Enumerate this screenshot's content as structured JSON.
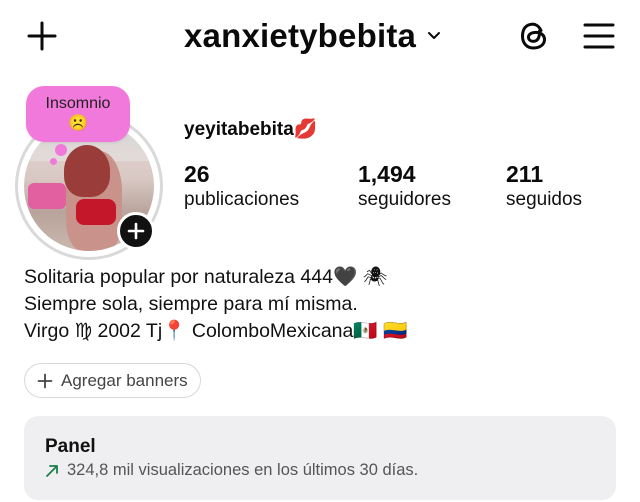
{
  "header": {
    "username": "xanxietybebita",
    "icons": [
      "plus-icon",
      "chevron-down-icon",
      "threads-icon",
      "hamburger-menu-icon"
    ]
  },
  "note": {
    "text": "Insomnio",
    "emoji": "☹️"
  },
  "profile": {
    "display_name": "yeyitabebita💋",
    "stats": [
      {
        "value": "26",
        "label": "publicaciones"
      },
      {
        "value": "1,494",
        "label": "seguidores"
      },
      {
        "value": "211",
        "label": "seguidos"
      }
    ],
    "bio": [
      "Solitaria popular por naturaleza 444🖤 🕷",
      "Siempre sola, siempre para mí misma.",
      "Virgo ♍ 2002 Tj📍 ColomboMexicana🇲🇽 🇨🇴"
    ]
  },
  "banners_button": {
    "label": "Agregar banners"
  },
  "panel": {
    "title": "Panel",
    "subtitle": "324,8 mil visualizaciones en los últimos 30 días.",
    "trend_color": "#1a7f4a"
  }
}
